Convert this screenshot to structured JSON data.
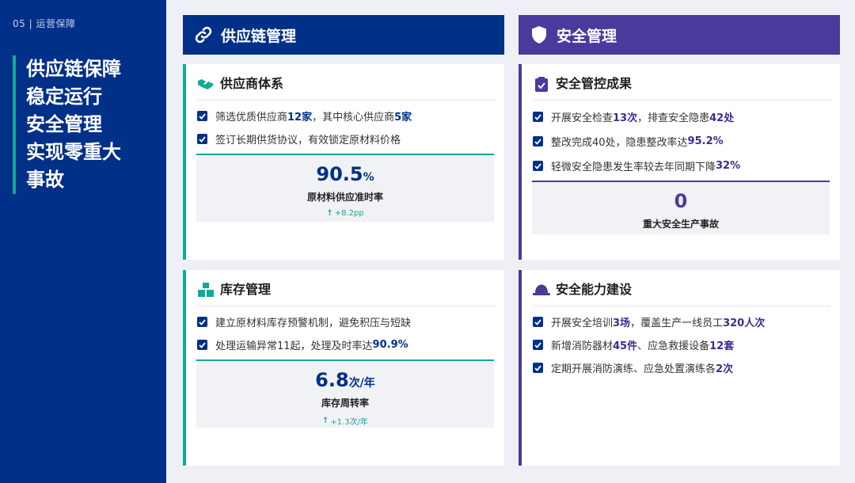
{
  "sidebar": {
    "section_tag": "05 | 运营保障",
    "headline": [
      "供应链保障",
      "稳定运行",
      "安全管理",
      "实现零重大",
      "事故"
    ]
  },
  "columns": {
    "left": {
      "title": "供应链管理",
      "icon": "link-icon"
    },
    "right": {
      "title": "安全管理",
      "icon": "shield-icon"
    }
  },
  "cards": {
    "supplier": {
      "title": "供应商体系",
      "icon": "handshake-icon",
      "items": [
        {
          "pre": "筛选优质供应商 ",
          "hl1": "12家",
          "mid": "，其中核心供应商 ",
          "hl2": "5家",
          "post": ""
        },
        {
          "pre": "签订长期供货协议，有效锁定原材料价格",
          "hl1": "",
          "mid": "",
          "hl2": "",
          "post": ""
        }
      ],
      "metric": {
        "value": "90.5",
        "unit": "%",
        "label": "原材料供应准时率",
        "delta": "+8.2pp"
      }
    },
    "inventory": {
      "title": "库存管理",
      "icon": "boxes-icon",
      "items": [
        {
          "pre": "建立原材料库存预警机制，避免积压与短缺",
          "hl1": "",
          "mid": "",
          "hl2": "",
          "post": ""
        },
        {
          "pre": "处理运输异常11起，处理及时率达 ",
          "hl1": "90.9%",
          "mid": "",
          "hl2": "",
          "post": ""
        }
      ],
      "metric": {
        "value": "6.8",
        "unit": "次/年",
        "label": "库存周转率",
        "delta": "+1.3次/年"
      }
    },
    "safety_results": {
      "title": "安全管控成果",
      "icon": "clipboard-check-icon",
      "items": [
        {
          "pre": "开展安全检查 ",
          "hl1": "13次",
          "mid": "，排查安全隐患 ",
          "hl2": "42处",
          "post": ""
        },
        {
          "pre": "整改完成40处，隐患整改率达 ",
          "hl1": "95.2%",
          "mid": "",
          "hl2": "",
          "post": ""
        },
        {
          "pre": "轻微安全隐患发生率较去年同期下降 ",
          "hl1": "32%",
          "mid": "",
          "hl2": "",
          "post": ""
        }
      ],
      "metric": {
        "value": "0",
        "unit": "",
        "label": "重大安全生产事故"
      }
    },
    "safety_capability": {
      "title": "安全能力建设",
      "icon": "hard-hat-icon",
      "items": [
        {
          "pre": "开展安全培训 ",
          "hl1": "3场",
          "mid": "，覆盖生产一线员工 ",
          "hl2": "320人次",
          "post": ""
        },
        {
          "pre": "新增消防器材 ",
          "hl1": "45件",
          "mid": "、应急救援设备 ",
          "hl2": "12套",
          "post": ""
        },
        {
          "pre": "定期开展消防演练、应急处置演练各 ",
          "hl1": "2次",
          "mid": "",
          "hl2": "",
          "post": ""
        }
      ]
    }
  },
  "colors": {
    "navy": "#003087",
    "purple": "#4a3a9e",
    "teal": "#14a89a"
  }
}
